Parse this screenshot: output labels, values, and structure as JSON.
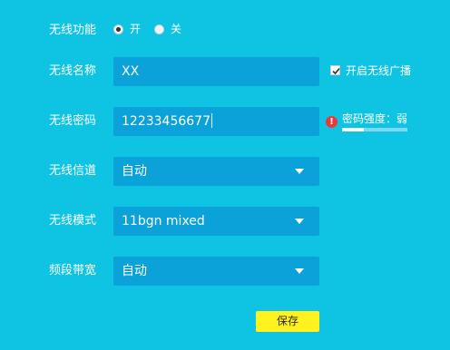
{
  "wireless_switch": {
    "label": "无线功能",
    "on_label": "开",
    "off_label": "关",
    "selected": "on"
  },
  "ssid": {
    "label": "无线名称",
    "value": "XX",
    "broadcast_label": "开启无线广播",
    "broadcast_checked": true
  },
  "password": {
    "label": "无线密码",
    "value": "12233456677",
    "strength_label": "密码强度：弱",
    "strength_level": 0.33
  },
  "channel": {
    "label": "无线信道",
    "value": "自动"
  },
  "mode": {
    "label": "无线模式",
    "value": "11bgn mixed"
  },
  "bandwidth": {
    "label": "频段带宽",
    "value": "自动"
  },
  "save_label": "保存",
  "icons": {
    "warning": "warning-icon",
    "dropdown": "chevron-down-icon",
    "check": "check-icon"
  }
}
